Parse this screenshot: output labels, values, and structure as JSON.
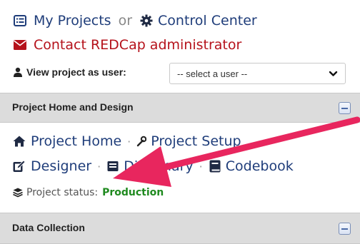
{
  "top": {
    "my_projects": "My Projects",
    "or_text": "or",
    "control_center": "Control Center",
    "contact_admin": "Contact REDCap administrator",
    "view_as_label": "View project as user:",
    "user_select_value": "-- select a user --"
  },
  "project_home_section": {
    "title": "Project Home and Design",
    "links": {
      "project_home": "Project Home",
      "project_setup": "Project Setup",
      "designer": "Designer",
      "dictionary": "Dictionary",
      "codebook": "Codebook"
    },
    "status_label": "Project status:",
    "status_value": "Production"
  },
  "data_collection_section": {
    "title": "Data Collection"
  },
  "colors": {
    "link": "#1f3d7a",
    "red": "#b5121b",
    "production_green": "#1f8a1f",
    "header_bg": "#dcdcdc",
    "annotation_arrow": "#e8265e"
  }
}
